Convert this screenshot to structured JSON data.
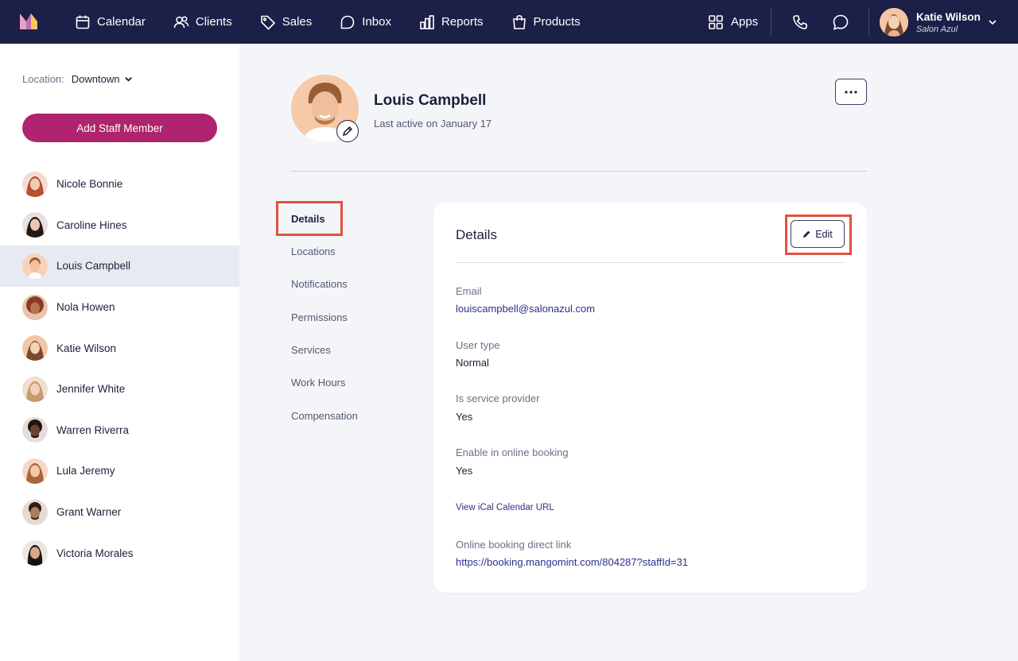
{
  "nav": {
    "items": [
      {
        "label": "Calendar",
        "icon": "calendar-icon"
      },
      {
        "label": "Clients",
        "icon": "users-icon"
      },
      {
        "label": "Sales",
        "icon": "tag-icon"
      },
      {
        "label": "Inbox",
        "icon": "inbox-icon"
      },
      {
        "label": "Reports",
        "icon": "bar-chart-icon"
      },
      {
        "label": "Products",
        "icon": "shopping-bag-icon"
      }
    ],
    "apps_label": "Apps",
    "user": {
      "name": "Katie Wilson",
      "salon": "Salon Azul"
    }
  },
  "sidebar": {
    "location_label": "Location:",
    "location_value": "Downtown",
    "add_button": "Add Staff Member",
    "staff": [
      {
        "name": "Nicole Bonnie",
        "color": "#e8a98a"
      },
      {
        "name": "Caroline Hines",
        "color": "#3b2a27"
      },
      {
        "name": "Louis Campbell",
        "color": "#e9b893",
        "active": true
      },
      {
        "name": "Nola Howen",
        "color": "#9b5a3c"
      },
      {
        "name": "Katie Wilson",
        "color": "#f1c39d"
      },
      {
        "name": "Jennifer White",
        "color": "#e6c0a3"
      },
      {
        "name": "Warren Riverra",
        "color": "#5a3a2a"
      },
      {
        "name": "Lula Jeremy",
        "color": "#edb894"
      },
      {
        "name": "Grant Warner",
        "color": "#7a4e35"
      },
      {
        "name": "Victoria Morales",
        "color": "#3a2620"
      }
    ]
  },
  "profile": {
    "name": "Louis Campbell",
    "last_active": "Last active on January 17"
  },
  "subnav": [
    "Details",
    "Locations",
    "Notifications",
    "Permissions",
    "Services",
    "Work Hours",
    "Compensation"
  ],
  "details": {
    "title": "Details",
    "edit_label": "Edit",
    "email_label": "Email",
    "email_value": "louiscampbell@salonazul.com",
    "user_type_label": "User type",
    "user_type_value": "Normal",
    "provider_label": "Is service provider",
    "provider_value": "Yes",
    "online_label": "Enable in online booking",
    "online_value": "Yes",
    "ical_link": "View iCal Calendar URL",
    "booking_label": "Online booking direct link",
    "booking_value": "https://booking.mangomint.com/804287?staffId=31"
  },
  "colors": {
    "nav_bg": "#1c1f47",
    "accent": "#b0246d",
    "highlight": "#e0523e",
    "link": "#2c318a"
  }
}
